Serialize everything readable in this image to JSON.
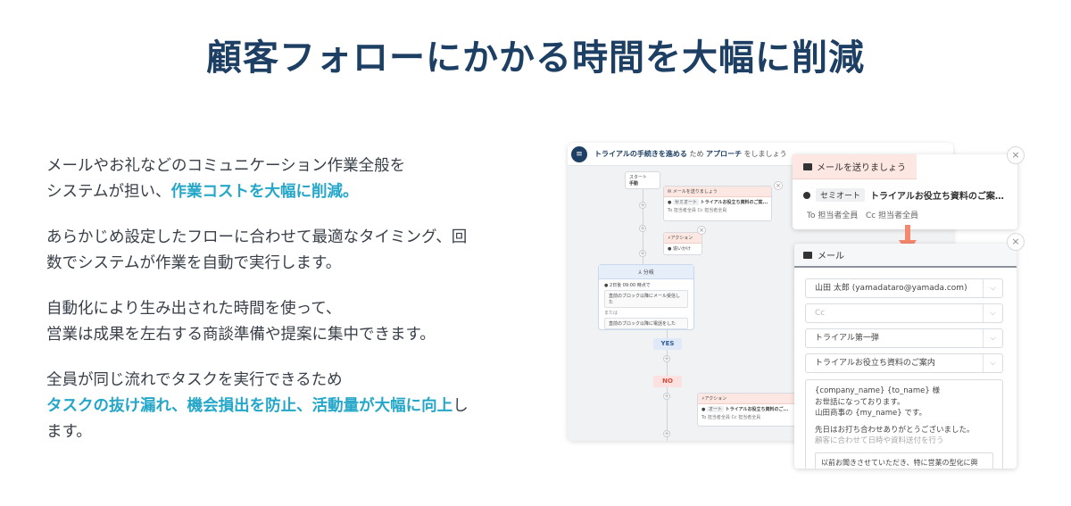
{
  "title": "顧客フォローにかかる時間を大幅に削減",
  "copy": {
    "p1_a": "メールやお礼などのコミュニケーション作業全般を",
    "p1_b": "システムが担い、",
    "p1_hl": "作業コストを大幅に削減。",
    "p2_a": "あらかじめ設定したフローに合わせて最適なタイミング、回",
    "p2_b": "数でシステムが作業を自動で実行します。",
    "p3_a": "自動化により生み出された時間を使って、",
    "p3_b": "営業は成果を左右する商談準備や提案に集中できます。",
    "p4_a": "全員が同じ流れでタスクを実行できるため",
    "p4_hl": "タスクの抜け漏れ、機会損出を防止、活動量が大幅に向上",
    "p4_b": "し",
    "p4_c": "ます。"
  },
  "app": {
    "menu_icon": "≡",
    "header_a": "トライアルの手続きを進める",
    "header_b": "ため",
    "header_c": "アプローチ",
    "header_d": "をしましょう",
    "start_a": "スタート",
    "start_b": "手動",
    "node_mail_tag": "メールを送りましょう",
    "node_mail_chip": "セミオート",
    "node_mail_subject": "トライアルお役立ち資料のご案...",
    "node_mail_to": "To 担当者全員   Cc 担当者全員",
    "node_action_tag": "アクション",
    "node_action_label": "追いかけ",
    "branch_title": "分岐",
    "branch_cond": "2日後 09:00 時点で",
    "branch_c1": "直前のブロック以降にメール受信した",
    "branch_or": "または",
    "branch_c2": "直前のブロック以降に電話をした",
    "yes": "YES",
    "no": "NO",
    "node2_tag": "アクション",
    "node2_chip": "オート",
    "node2_subject": "トライアルお役立ち資料のご...",
    "node2_to": "To 担当者全員   Cc 担当者全員"
  },
  "popup1": {
    "tag": "メールを送りましょう",
    "chip": "セミオート",
    "subject": "トライアルお役立ち資料のご案…",
    "to": "To 担当者全員",
    "cc": "Cc 担当者全員",
    "close": "×"
  },
  "popup2": {
    "title": "メール",
    "close": "×",
    "to_value": "山田 太郎 (yamadataro@yamada.com)",
    "cc_placeholder": "Cc",
    "template": "トライアル第一弾",
    "subject": "トライアルお役立ち資料のご案内",
    "body_1": "{company_name} {to_name} 様",
    "body_2": "お世話になっております。",
    "body_3": "山田商事の {my_name} です。",
    "body_4": "先日はお打ち合わせありがとうございました。",
    "body_5": "顧客に合わせて日時や資料送付を行う",
    "body_6": "以前お聞きさせていただき、特に営業の型化に興"
  },
  "colors": {
    "title": "#1d3f63",
    "highlight": "#24a7c9",
    "arrow": "#f4876d"
  }
}
